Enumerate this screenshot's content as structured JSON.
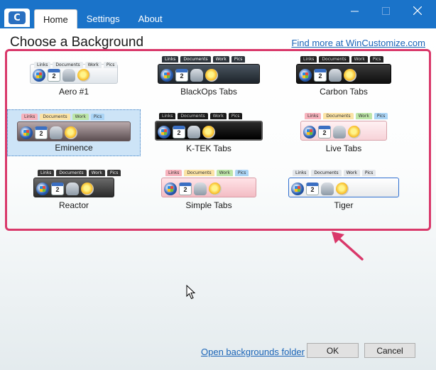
{
  "app": {
    "logo_glyph": "C"
  },
  "tabs": [
    {
      "label": "Home",
      "active": true
    },
    {
      "label": "Settings",
      "active": false
    },
    {
      "label": "About",
      "active": false
    }
  ],
  "main": {
    "title": "Choose a Background",
    "find_more_link": "Find more at WinCustomize.com"
  },
  "backgrounds": [
    {
      "label": "Aero #1",
      "selected": false,
      "style": "aero"
    },
    {
      "label": "BlackOps Tabs",
      "selected": false,
      "style": "blackops"
    },
    {
      "label": "Carbon Tabs",
      "selected": false,
      "style": "carbon"
    },
    {
      "label": "Eminence",
      "selected": true,
      "style": "eminence"
    },
    {
      "label": "K-TEK Tabs",
      "selected": false,
      "style": "ktek"
    },
    {
      "label": "Live Tabs",
      "selected": false,
      "style": "live"
    },
    {
      "label": "Reactor",
      "selected": false,
      "style": "reactor"
    },
    {
      "label": "Simple Tabs",
      "selected": false,
      "style": "simple"
    },
    {
      "label": "Tiger",
      "selected": false,
      "style": "tiger"
    }
  ],
  "thumbnail_tabs": [
    "Links",
    "Documents",
    "Work",
    "Pics"
  ],
  "thumbnail_calendar_day": "2",
  "footer": {
    "open_folder_link": "Open backgrounds folder",
    "ok_label": "OK",
    "cancel_label": "Cancel"
  },
  "colors": {
    "titlebar": "#1a73c9",
    "highlight_border": "#d9386a",
    "link": "#1a64b7",
    "selection": "#cde4f7"
  }
}
